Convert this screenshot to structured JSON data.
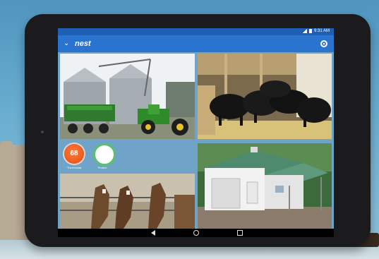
{
  "status_bar": {
    "time": "9:31 AM"
  },
  "app_bar": {
    "logo": "nest",
    "menu_icon": "chevron-down-icon",
    "settings_icon": "gear-icon"
  },
  "devices": [
    {
      "name": "Thermostat",
      "value": "68",
      "color": "#e9571f"
    },
    {
      "name": "Protect",
      "color": "#5bc26b"
    }
  ],
  "cameras": [
    {
      "id": "grain-bins-tractor",
      "icon": "camera-feed"
    },
    {
      "id": "cattle-barn",
      "icon": "camera-feed"
    },
    {
      "id": "horses",
      "icon": "camera-feed"
    },
    {
      "id": "garage",
      "icon": "camera-feed"
    }
  ],
  "nav": {
    "back": "back-icon",
    "home": "home-icon",
    "recents": "recents-icon"
  },
  "colors": {
    "status_bar": "#1f5fb3",
    "app_bar": "#2a74cf",
    "screen_bg": "#6fa3c7"
  }
}
